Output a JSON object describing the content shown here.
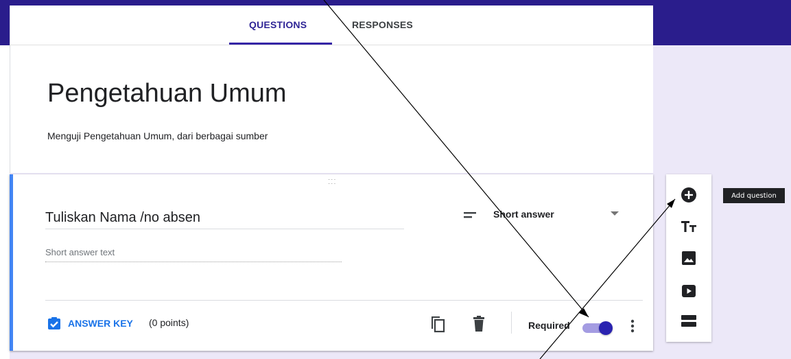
{
  "tabs": {
    "questions": "QUESTIONS",
    "responses": "RESPONSES"
  },
  "form": {
    "title": "Pengetahuan Umum",
    "description": "Menguji Pengetahuan Umum, dari berbagai sumber"
  },
  "question": {
    "title": "Tuliskan Nama /no absen",
    "type": "Short answer",
    "answer_placeholder": "Short answer text",
    "answer_key_label": "ANSWER KEY",
    "points": "(0 points)",
    "required_label": "Required",
    "required_on": true
  },
  "toolbar": {
    "tooltip": "Add question",
    "icons": [
      "add-circle-icon",
      "title-text-icon",
      "image-icon",
      "video-icon",
      "section-icon"
    ]
  },
  "colors": {
    "header_band": "#2a1d8c",
    "accent": "#3525a6",
    "answer_key_blue": "#1a73e8",
    "question_border": "#4285f4",
    "toggle_track": "#a49ce2",
    "toggle_knob": "#2a23b0"
  }
}
